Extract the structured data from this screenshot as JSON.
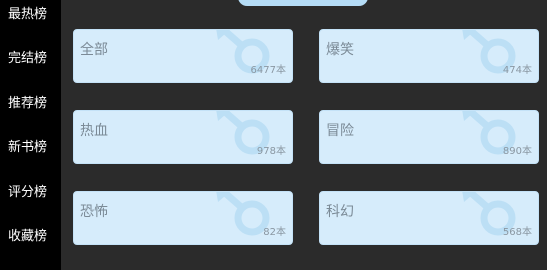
{
  "sidebar": {
    "items": [
      {
        "label": "最热榜"
      },
      {
        "label": "完结榜"
      },
      {
        "label": "推荐榜"
      },
      {
        "label": "新书榜"
      },
      {
        "label": "评分榜"
      },
      {
        "label": "收藏榜"
      }
    ]
  },
  "categories": [
    {
      "label": "全部",
      "count": "6477本"
    },
    {
      "label": "爆笑",
      "count": "474本"
    },
    {
      "label": "热血",
      "count": "978本"
    },
    {
      "label": "冒险",
      "count": "890本"
    },
    {
      "label": "恐怖",
      "count": "82本"
    },
    {
      "label": "科幻",
      "count": "568本"
    }
  ],
  "icons": {
    "card_watermark": "male-symbol-icon"
  },
  "colors": {
    "sidebar_bg": "#000000",
    "content_bg": "#2b2b2b",
    "card_bg": "#d6ecfb",
    "accent": "#b5dcf6"
  }
}
